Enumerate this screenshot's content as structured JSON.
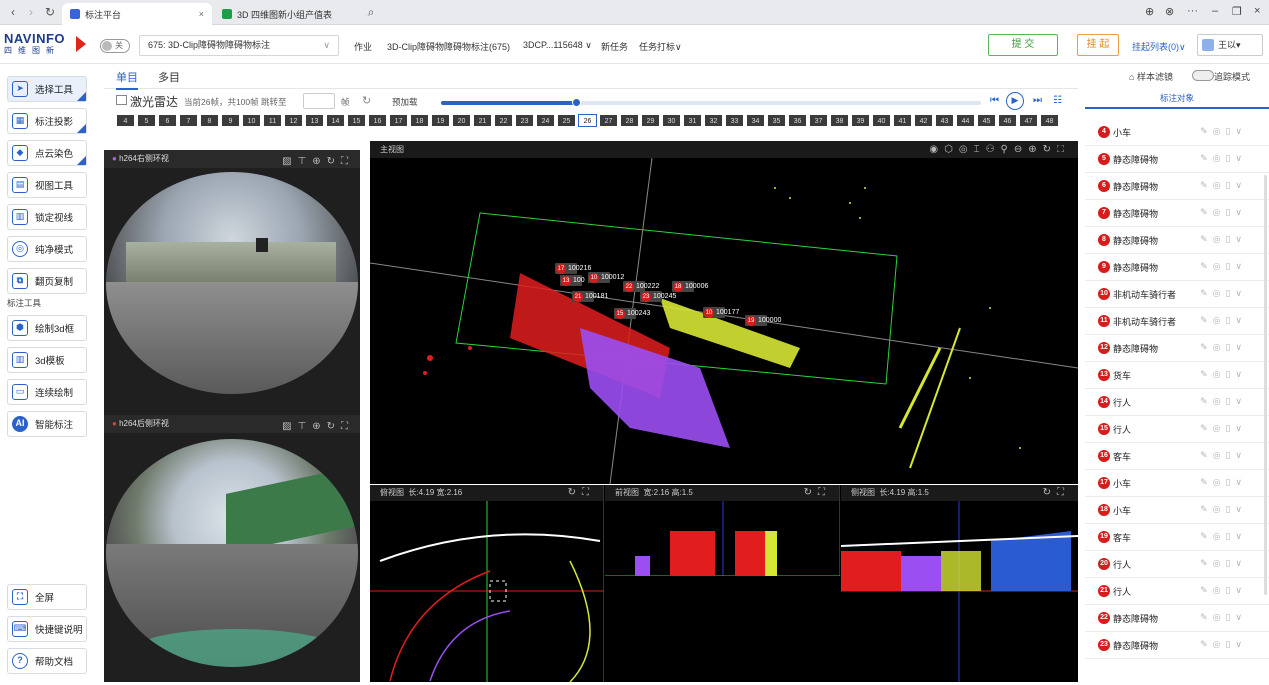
{
  "browser": {
    "tabs": [
      {
        "title": "标注平台",
        "color": "#3b63d8",
        "active": true
      },
      {
        "title": "3D 四维图新小组产值表",
        "color": "#1e9e4a",
        "active": false
      }
    ]
  },
  "header": {
    "logo_text": "NAVINFO",
    "logo_sub": "四维图新",
    "toggle_label": "关",
    "task_select": "675: 3D-Clip障碍物障碍物标注",
    "job_label": "作业",
    "job_name": "3D-Clip障碍物障碍物标注(675)",
    "job_code": "3DCP...115648 ∨",
    "new_task": "新任务",
    "task_mark": "任务打标∨",
    "submit": "提 交",
    "hang": "挂 起",
    "hang_list": "挂起列表(0)∨",
    "user": "王以▾"
  },
  "left_tools": [
    {
      "label": "选择工具",
      "icon": "select-icon",
      "corner": true
    },
    {
      "label": "标注投影",
      "icon": "projection-icon",
      "corner": true
    },
    {
      "label": "点云染色",
      "icon": "pointcloud-color-icon",
      "corner": true
    },
    {
      "label": "视图工具",
      "icon": "view-tool-icon",
      "corner": false
    },
    {
      "label": "锁定视线",
      "icon": "lock-view-icon",
      "corner": false
    },
    {
      "label": "纯净模式",
      "icon": "clean-mode-icon",
      "corner": false
    },
    {
      "label": "翻页复制",
      "icon": "page-copy-icon",
      "corner": false
    }
  ],
  "annotation_section_label": "标注工具",
  "annotation_tools": [
    {
      "label": "绘制3d框",
      "icon": "draw-3dbox-icon"
    },
    {
      "label": "3d模板",
      "icon": "3d-template-icon"
    },
    {
      "label": "连续绘制",
      "icon": "continuous-draw-icon"
    },
    {
      "label": "智能标注",
      "icon": "ai-label-icon"
    }
  ],
  "bottom_tools": [
    {
      "label": "全屏",
      "icon": "fullscreen-icon"
    },
    {
      "label": "快捷键说明",
      "icon": "keyboard-icon"
    },
    {
      "label": "帮助文档",
      "icon": "help-icon"
    }
  ],
  "main": {
    "tabs": [
      "单目",
      "多目"
    ],
    "lidar_label": "激光雷达",
    "frame_info": "当前26帧，共100帧 跳转至",
    "frame_unit": "帧",
    "preload": "预加载",
    "frames": [
      "4",
      "5",
      "6",
      "7",
      "8",
      "9",
      "10",
      "11",
      "12",
      "13",
      "14",
      "15",
      "16",
      "17",
      "18",
      "19",
      "20",
      "21",
      "22",
      "23",
      "24",
      "25",
      "26",
      "27",
      "28",
      "29",
      "30",
      "31",
      "32",
      "33",
      "34",
      "35",
      "36",
      "37",
      "38",
      "39",
      "40",
      "41",
      "42",
      "43",
      "44",
      "45",
      "46",
      "47",
      "48"
    ],
    "current_frame": "26",
    "cam1_title": "h264右侧环视",
    "cam2_title": "h264后侧环视",
    "main_view_title": "主视图",
    "top_view_title": "俯视图",
    "top_view_dims": "长:4.19 宽:2.16",
    "front_view_title": "前视图",
    "front_view_dims": "宽:2.16 高:1.5",
    "side_view_title": "侧视图",
    "side_view_dims": "长:4.19 高:1.5",
    "tags": [
      {
        "n": "17",
        "id": "100216"
      },
      {
        "n": "13",
        "id": "100"
      },
      {
        "n": "10",
        "id": "100012"
      },
      {
        "n": "22",
        "id": "100222"
      },
      {
        "n": "18",
        "id": "100006"
      },
      {
        "n": "21",
        "id": "100181"
      },
      {
        "n": "23",
        "id": "100245"
      },
      {
        "n": "10",
        "id": "100177"
      },
      {
        "n": "15",
        "id": "100243"
      },
      {
        "n": "19",
        "id": "100000"
      }
    ]
  },
  "right_panel": {
    "sample_filter": "样本滤镜",
    "track_mode": "追踪模式",
    "section_title": "标注对象",
    "objects": [
      {
        "n": "4",
        "name": "小车"
      },
      {
        "n": "5",
        "name": "静态障碍物"
      },
      {
        "n": "6",
        "name": "静态障碍物"
      },
      {
        "n": "7",
        "name": "静态障碍物"
      },
      {
        "n": "8",
        "name": "静态障碍物"
      },
      {
        "n": "9",
        "name": "静态障碍物"
      },
      {
        "n": "10",
        "name": "非机动车骑行者"
      },
      {
        "n": "11",
        "name": "非机动车骑行者"
      },
      {
        "n": "12",
        "name": "静态障碍物"
      },
      {
        "n": "13",
        "name": "货车"
      },
      {
        "n": "14",
        "name": "行人"
      },
      {
        "n": "15",
        "name": "行人"
      },
      {
        "n": "16",
        "name": "客车"
      },
      {
        "n": "17",
        "name": "小车"
      },
      {
        "n": "18",
        "name": "小车"
      },
      {
        "n": "19",
        "name": "客车"
      },
      {
        "n": "20",
        "name": "行人"
      },
      {
        "n": "21",
        "name": "行人"
      },
      {
        "n": "22",
        "name": "静态障碍物"
      },
      {
        "n": "23",
        "name": "静态障碍物"
      }
    ]
  }
}
